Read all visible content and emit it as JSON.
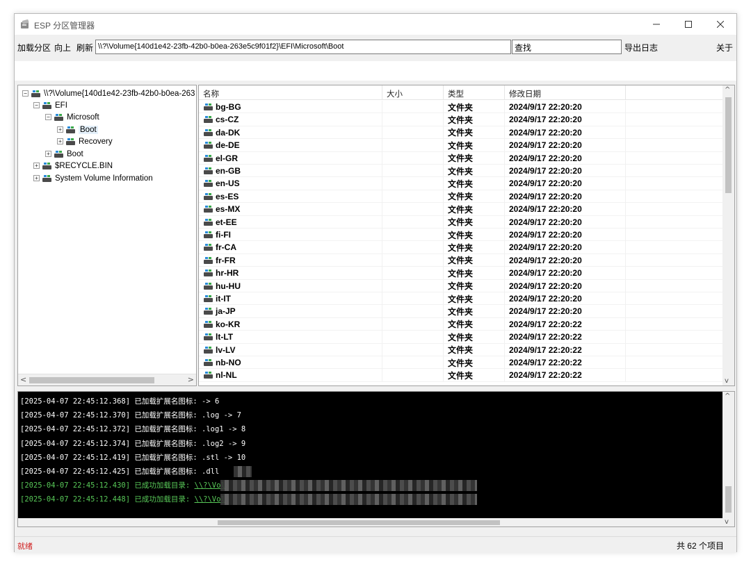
{
  "window": {
    "title": "ESP 分区管理器",
    "controls": {
      "minimize": "—",
      "maximize": "☐",
      "close": "✕"
    }
  },
  "toolbar": {
    "load_partition": "加载分区",
    "up": "向上",
    "refresh": "刷新",
    "path_value": "\\\\?\\Volume{140d1e42-23fb-42b0-b0ea-263e5c9f01f2}\\EFI\\Microsoft\\Boot",
    "search_value": "查找",
    "export_log": "导出日志",
    "about": "关于"
  },
  "tree": {
    "root": "\\\\?\\Volume{140d1e42-23fb-42b0-b0ea-263",
    "nodes": [
      {
        "label": "EFI",
        "expander": "−"
      },
      {
        "label": "Microsoft",
        "expander": "−"
      },
      {
        "label": "Boot",
        "expander": "+"
      },
      {
        "label": "Recovery",
        "expander": "+"
      },
      {
        "label": "Boot",
        "expander": "+"
      },
      {
        "label": "$RECYCLE.BIN",
        "expander": "+"
      },
      {
        "label": "System Volume Information",
        "expander": "+"
      }
    ],
    "root_expander": "−",
    "scroll_left": "<",
    "scroll_right": ">"
  },
  "list": {
    "columns": {
      "name": "名称",
      "size": "大小",
      "type": "类型",
      "date": "修改日期"
    },
    "rows": [
      {
        "name": "bg-BG",
        "size": "",
        "type": "文件夹",
        "date": "2024/9/17 22:20:20"
      },
      {
        "name": "cs-CZ",
        "size": "",
        "type": "文件夹",
        "date": "2024/9/17 22:20:20"
      },
      {
        "name": "da-DK",
        "size": "",
        "type": "文件夹",
        "date": "2024/9/17 22:20:20"
      },
      {
        "name": "de-DE",
        "size": "",
        "type": "文件夹",
        "date": "2024/9/17 22:20:20"
      },
      {
        "name": "el-GR",
        "size": "",
        "type": "文件夹",
        "date": "2024/9/17 22:20:20"
      },
      {
        "name": "en-GB",
        "size": "",
        "type": "文件夹",
        "date": "2024/9/17 22:20:20"
      },
      {
        "name": "en-US",
        "size": "",
        "type": "文件夹",
        "date": "2024/9/17 22:20:20"
      },
      {
        "name": "es-ES",
        "size": "",
        "type": "文件夹",
        "date": "2024/9/17 22:20:20"
      },
      {
        "name": "es-MX",
        "size": "",
        "type": "文件夹",
        "date": "2024/9/17 22:20:20"
      },
      {
        "name": "et-EE",
        "size": "",
        "type": "文件夹",
        "date": "2024/9/17 22:20:20"
      },
      {
        "name": "fi-FI",
        "size": "",
        "type": "文件夹",
        "date": "2024/9/17 22:20:20"
      },
      {
        "name": "fr-CA",
        "size": "",
        "type": "文件夹",
        "date": "2024/9/17 22:20:20"
      },
      {
        "name": "fr-FR",
        "size": "",
        "type": "文件夹",
        "date": "2024/9/17 22:20:20"
      },
      {
        "name": "hr-HR",
        "size": "",
        "type": "文件夹",
        "date": "2024/9/17 22:20:20"
      },
      {
        "name": "hu-HU",
        "size": "",
        "type": "文件夹",
        "date": "2024/9/17 22:20:20"
      },
      {
        "name": "it-IT",
        "size": "",
        "type": "文件夹",
        "date": "2024/9/17 22:20:20"
      },
      {
        "name": "ja-JP",
        "size": "",
        "type": "文件夹",
        "date": "2024/9/17 22:20:20"
      },
      {
        "name": "ko-KR",
        "size": "",
        "type": "文件夹",
        "date": "2024/9/17 22:20:22"
      },
      {
        "name": "lt-LT",
        "size": "",
        "type": "文件夹",
        "date": "2024/9/17 22:20:22"
      },
      {
        "name": "lv-LV",
        "size": "",
        "type": "文件夹",
        "date": "2024/9/17 22:20:22"
      },
      {
        "name": "nb-NO",
        "size": "",
        "type": "文件夹",
        "date": "2024/9/17 22:20:22"
      },
      {
        "name": "nl-NL",
        "size": "",
        "type": "文件夹",
        "date": "2024/9/17 22:20:22"
      }
    ],
    "scroll_up": "^",
    "scroll_down": "v"
  },
  "console": {
    "lines": [
      {
        "text": "[2025-04-07 22:45:12.368] 已加载扩展名图标:  -> 6",
        "style": "normal"
      },
      {
        "text": "[2025-04-07 22:45:12.370] 已加载扩展名图标: .log -> 7",
        "style": "normal"
      },
      {
        "text": "[2025-04-07 22:45:12.372] 已加载扩展名图标: .log1 -> 8",
        "style": "normal"
      },
      {
        "text": "[2025-04-07 22:45:12.374] 已加载扩展名图标: .log2 -> 9",
        "style": "normal"
      },
      {
        "text": "[2025-04-07 22:45:12.419] 已加载扩展名图标: .stl -> 10",
        "style": "normal"
      },
      {
        "text": "[2025-04-07 22:45:12.425] 已加载扩展名图标: .dll",
        "style": "normal"
      },
      {
        "text": "[2025-04-07 22:45:12.430] 已成功加载目录: ",
        "link": "\\\\?\\Vol",
        "style": "ok"
      },
      {
        "text": "[2025-04-07 22:45:12.448] 已成功加载目录: ",
        "link": "\\\\?\\Vol",
        "style": "ok"
      }
    ],
    "colors": {
      "background": "#000000",
      "normal": "#ffffff",
      "ok": "#58c858"
    }
  },
  "status": {
    "state": "就绪",
    "count": "共 62 个项目",
    "state_color": "#d02020"
  }
}
